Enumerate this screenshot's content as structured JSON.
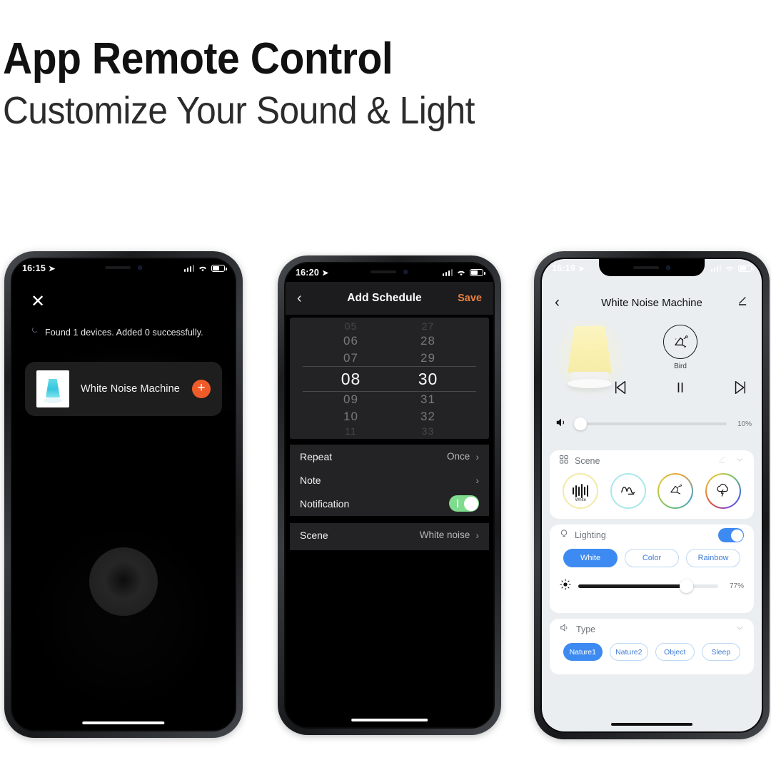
{
  "header": {
    "title": "App Remote Control",
    "subtitle": "Customize Your Sound & Light"
  },
  "phone1": {
    "status": {
      "time": "16:15",
      "location_icon": "location-arrow-icon",
      "signal_icon": "cellular-bars-icon",
      "wifi_icon": "wifi-icon",
      "battery_icon": "battery-icon"
    },
    "close_label": "✕",
    "found_text": "Found 1 devices. Added 0 successfully.",
    "device": {
      "name": "White Noise Machine",
      "add_label": "+",
      "thumb_icon": "white-noise-machine-thumb"
    }
  },
  "phone2": {
    "status": {
      "time": "16:20"
    },
    "nav": {
      "back_label": "‹",
      "title": "Add Schedule",
      "save_label": "Save"
    },
    "picker": {
      "hours": [
        "05",
        "06",
        "07",
        "08",
        "09",
        "10",
        "11"
      ],
      "minutes": [
        "27",
        "28",
        "29",
        "30",
        "31",
        "32",
        "33"
      ],
      "selected_hour": "08",
      "selected_minute": "30"
    },
    "rows": [
      {
        "label": "Repeat",
        "value": "Once",
        "chevron": "›"
      },
      {
        "label": "Note",
        "value": "",
        "chevron": "›"
      },
      {
        "label": "Notification",
        "value": "",
        "toggle": "on"
      }
    ],
    "scene_row": {
      "label": "Scene",
      "value": "White noise",
      "chevron": "›"
    }
  },
  "phone3": {
    "status": {
      "time": "16:19"
    },
    "nav": {
      "back_label": "‹",
      "title": "White Noise Machine",
      "edit_icon": "pencil-edit-icon"
    },
    "hero": {
      "lamp_icon": "night-lamp-image",
      "current_scene_icon": "bird-icon",
      "current_scene_label": "Bird",
      "prev_label": "⏮",
      "play_pause_label": "⏸",
      "next_label": "⏭"
    },
    "volume": {
      "icon": "speaker-volume-icon",
      "value": "10%",
      "percent": 10
    },
    "scene": {
      "title": "Scene",
      "grid_icon": "grid-icon",
      "edit_icon": "pencil-icon",
      "collapse_icon": "chevron-down-icon",
      "items": [
        {
          "name": "white-noise-scene",
          "label": "White",
          "icon": "waveform-icon"
        },
        {
          "name": "wave-scene",
          "label": "",
          "icon": "wave-icon"
        },
        {
          "name": "bird-scene",
          "label": "",
          "icon": "bird-icon"
        },
        {
          "name": "thunder-scene",
          "label": "",
          "icon": "thunder-cloud-icon"
        }
      ]
    },
    "lighting": {
      "title": "Lighting",
      "bulb_icon": "bulb-icon",
      "toggle": "on",
      "modes": [
        "White",
        "Color",
        "Rainbow"
      ],
      "selected_mode": "White",
      "brightness_icon": "brightness-icon",
      "brightness": "77%",
      "brightness_percent": 77
    },
    "type": {
      "title": "Type",
      "speaker_icon": "speaker-icon",
      "collapse_icon": "chevron-down-icon",
      "options": [
        "Nature1",
        "Nature2",
        "Object",
        "Sleep"
      ],
      "selected_option": "Nature1"
    }
  },
  "colors": {
    "accent_orange": "#f05b2a",
    "save_orange": "#e8813f",
    "blue": "#3d8bf2",
    "toggle_green": "#7fdc8e",
    "lamp_yellow": "#f9f0ae"
  }
}
